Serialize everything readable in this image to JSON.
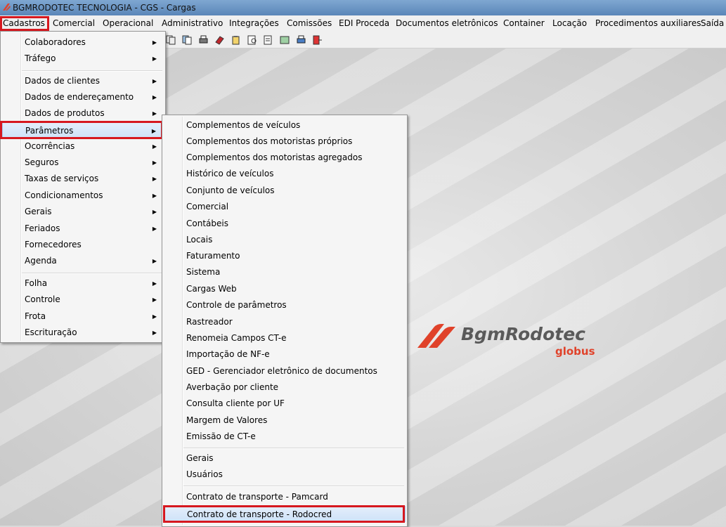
{
  "window": {
    "title": "BGMRODOTEC TECNOLOGIA - CGS - Cargas"
  },
  "menubar": {
    "items": [
      "Cadastros",
      "Comercial",
      "Operacional",
      "Administrativo",
      "Integrações",
      "Comissões",
      "EDI Proceda",
      "Documentos eletrônicos",
      "Container",
      "Locação",
      "Procedimentos auxiliares",
      "Saída"
    ]
  },
  "cadastros_menu": {
    "items": [
      "Colaboradores",
      "Tráfego",
      "Dados de clientes",
      "Dados de endereçamento",
      "Dados de produtos",
      "Parâmetros",
      "Ocorrências",
      "Seguros",
      "Taxas de serviços",
      "Condicionamentos",
      "Gerais",
      "Feriados",
      "Fornecedores",
      "Agenda",
      "Folha",
      "Controle",
      "Frota",
      "Escrituração"
    ]
  },
  "parametros_menu": {
    "items": [
      "Complementos de veículos",
      "Complementos dos motoristas próprios",
      "Complementos dos motoristas agregados",
      "Histórico de veículos",
      "Conjunto de veículos",
      "Comercial",
      "Contábeis",
      "Locais",
      "Faturamento",
      "Sistema",
      "Cargas Web",
      "Controle de parâmetros",
      "Rastreador",
      "Renomeia Campos CT-e",
      "Importação de NF-e",
      "GED - Gerenciador eletrônico de documentos",
      "Averbação por cliente",
      "Consulta cliente por UF",
      "Margem de Valores",
      "Emissão de CT-e",
      "Gerais",
      "Usuários",
      "Contrato de transporte - Pamcard",
      "Contrato de transporte - Rodocred"
    ]
  },
  "logo": {
    "brand": "BgmRodotec",
    "sub": "globus"
  },
  "colors": {
    "highlight_box": "#d6181f",
    "logo_red": "#e0422a"
  }
}
